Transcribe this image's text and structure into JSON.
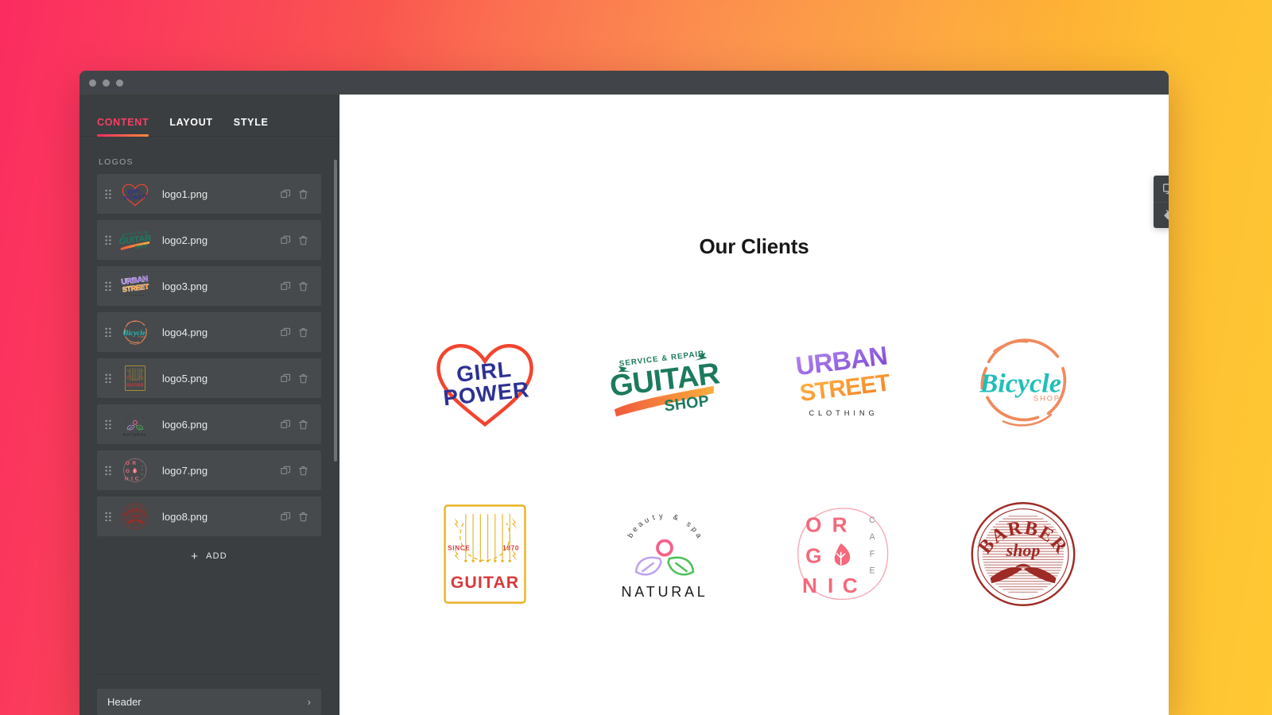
{
  "window": {
    "traffic_lights": [
      "close",
      "minimize",
      "zoom"
    ]
  },
  "sidebar": {
    "tabs": [
      {
        "label": "CONTENT",
        "active": true
      },
      {
        "label": "LAYOUT",
        "active": false
      },
      {
        "label": "STYLE",
        "active": false
      }
    ],
    "section_label": "LOGOS",
    "items": [
      {
        "name": "logo1.png",
        "thumb": "girl-power"
      },
      {
        "name": "logo2.png",
        "thumb": "guitar-shop"
      },
      {
        "name": "logo3.png",
        "thumb": "urban-street"
      },
      {
        "name": "logo4.png",
        "thumb": "bicycle-shop"
      },
      {
        "name": "logo5.png",
        "thumb": "guitar-1970"
      },
      {
        "name": "logo6.png",
        "thumb": "natural-spa"
      },
      {
        "name": "logo7.png",
        "thumb": "organic-cafe"
      },
      {
        "name": "logo8.png",
        "thumb": "barber-shop"
      }
    ],
    "add_label": "ADD",
    "add_plus": "+",
    "footer": {
      "header_label": "Header",
      "chevron": "›"
    },
    "row_actions": {
      "duplicate": "duplicate-icon",
      "delete": "trash-icon"
    }
  },
  "canvas": {
    "title": "Our Clients",
    "logos": [
      {
        "id": "girl-power",
        "lines": [
          "GIRL",
          "POWER"
        ],
        "shape": "heart",
        "colors": {
          "text": "#2E3192",
          "outline": "#F4442E"
        }
      },
      {
        "id": "guitar-shop",
        "lines": [
          "SERVICE & REPAIR",
          "GUITAR",
          "SHOP"
        ],
        "shape": "banner",
        "colors": {
          "text": "#1C7A5E",
          "accent": "#F05A3C",
          "accent2": "#FBAE3C"
        }
      },
      {
        "id": "urban-street",
        "lines": [
          "URBAN",
          "STREET",
          "CLOTHING"
        ],
        "shape": "block",
        "colors": {
          "top": "#9B5DE5",
          "bottom": "#F79824",
          "sub": "#2B2B2B"
        }
      },
      {
        "id": "bicycle-shop",
        "lines": [
          "Bicycle",
          "SHOP"
        ],
        "shape": "circle-brush",
        "colors": {
          "text": "#1FBFB8",
          "ring": "#F08A5D"
        }
      },
      {
        "id": "guitar-1970",
        "lines": [
          "SINCE",
          "1970",
          "GUITAR"
        ],
        "shape": "rect-frame",
        "colors": {
          "frame": "#E8B323",
          "text": "#D8393C"
        }
      },
      {
        "id": "natural-spa",
        "lines": [
          "beauty & spa",
          "NATURAL"
        ],
        "shape": "leaves",
        "colors": {
          "text": "#1A1A1A",
          "leaf_left": "#BFA4F0",
          "leaf_right": "#4CC25A",
          "bud": "#F6608A"
        }
      },
      {
        "id": "organic-cafe",
        "lines": [
          "OR",
          "G",
          "NIC",
          "CAFE"
        ],
        "shape": "soft-circle",
        "colors": {
          "text": "#F4697B",
          "ring": "#F9A8B4"
        }
      },
      {
        "id": "barber-shop",
        "lines": [
          "BARBER",
          "shop"
        ],
        "shape": "stamp",
        "colors": {
          "text": "#9E2B25",
          "ring": "#9E2B25"
        }
      }
    ]
  },
  "float_toolbar": {
    "buttons": [
      {
        "icon": "desktop-preview-icon",
        "name": "preview-device"
      },
      {
        "icon": "paint-bucket-icon",
        "name": "background-fill"
      }
    ]
  },
  "colors": {
    "accent_pink": "#FB2C60",
    "accent_orange": "#FD8B3C",
    "accent_yellow": "#FFC933",
    "panel_bg": "#3B3E40",
    "row_bg": "#464A4C"
  }
}
